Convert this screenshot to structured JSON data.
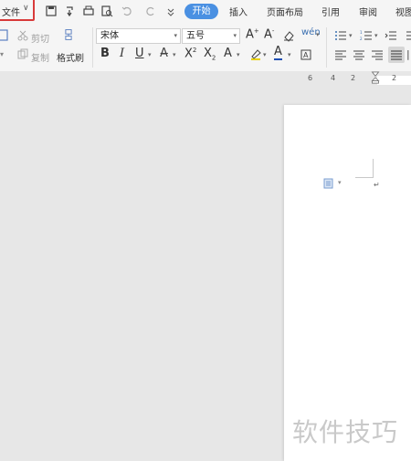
{
  "titlebar": {
    "file_label": "文件",
    "tabs": [
      "开始",
      "插入",
      "页面布局",
      "引用",
      "审阅",
      "视图"
    ],
    "active_tab": "开始"
  },
  "ribbon": {
    "cut_label": "剪切",
    "copy_label": "复制",
    "format_painter_label": "格式刷",
    "font_name": "宋体",
    "font_size": "五号"
  },
  "ruler": {
    "ticks": [
      "6",
      "4",
      "2",
      "2"
    ]
  },
  "watermark": "软件技巧",
  "colors": {
    "accent": "#4a90e2",
    "highlight_border": "#d83a3a",
    "font_color": "#1f4fb3"
  }
}
